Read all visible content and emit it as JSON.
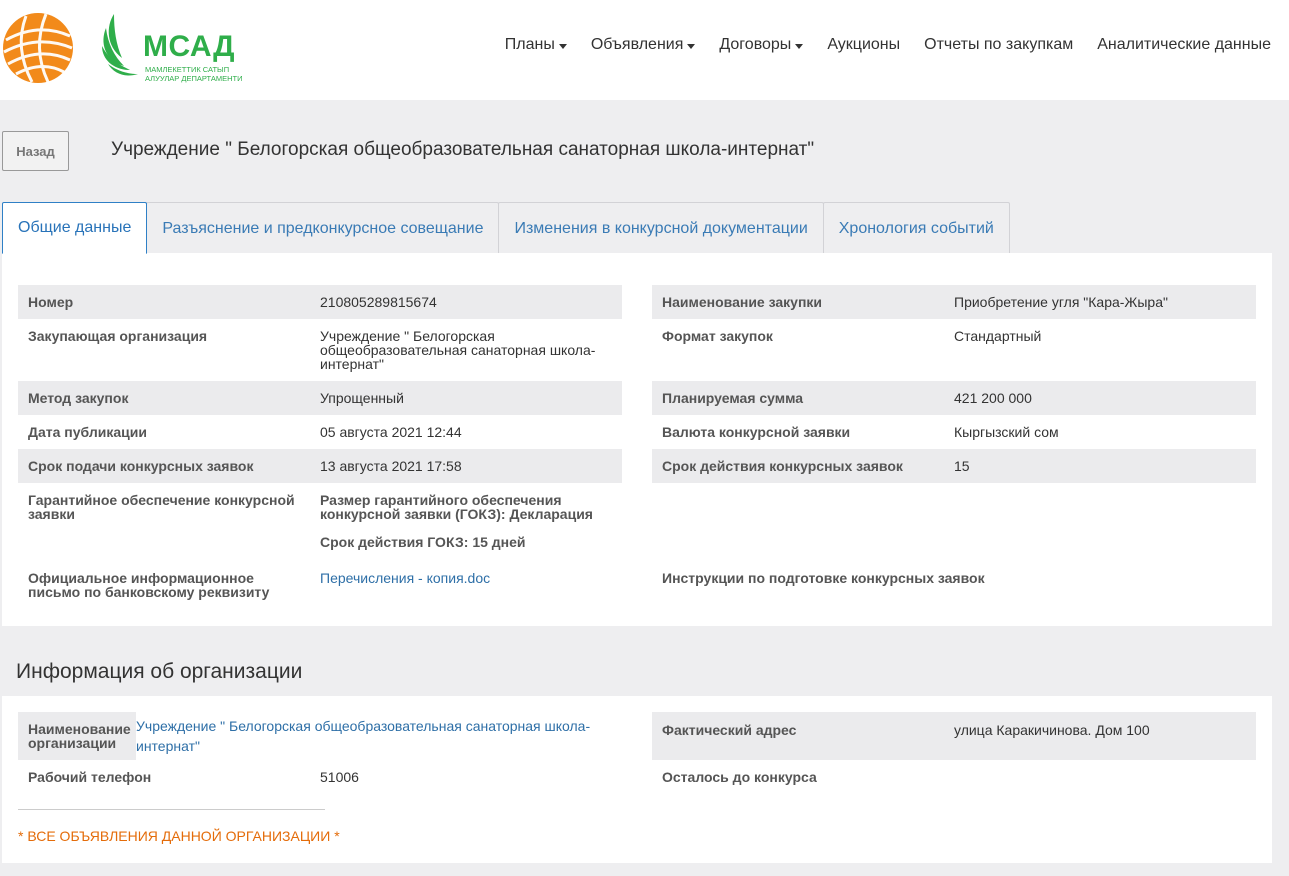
{
  "header": {
    "brand": "МСАД",
    "brand_sub": [
      "МАМЛЕКЕТТИК САТЫП",
      "АЛУУЛАР ДЕПАРТАМЕНТИ"
    ],
    "nav": [
      {
        "label": "Планы",
        "dropdown": true
      },
      {
        "label": "Объявления",
        "dropdown": true
      },
      {
        "label": "Договоры",
        "dropdown": true
      },
      {
        "label": "Аукционы",
        "dropdown": false
      },
      {
        "label": "Отчеты по закупкам",
        "dropdown": false
      },
      {
        "label": "Аналитические данные",
        "dropdown": false
      }
    ]
  },
  "back_label": "Назад",
  "page_title": "Учреждение \" Белогорская общеобразовательная санаторная школа-интернат\"",
  "tabs": [
    "Общие данные",
    "Разъяснение и предконкурсное совещание",
    "Изменения в конкурсной документации",
    "Хронология событий"
  ],
  "general": {
    "number_label": "Номер",
    "number": "210805289815674",
    "org_label": "Закупающая организация",
    "org": "Учреждение \" Белогорская общеобразовательная санаторная школа-интернат\"",
    "method_label": "Метод закупок",
    "method": "Упрощенный",
    "pub_label": "Дата публикации",
    "pub": "05 августа 2021 12:44",
    "deadline_label": "Срок подачи конкурсных заявок",
    "deadline": "13 августа 2021 17:58",
    "guarantee_label": "Гарантийное обеспечение конкурсной заявки",
    "guarantee_size": "Размер гарантийного обеспечения конкурсной заявки (ГОКЗ): Декларация",
    "guarantee_term": "Срок действия ГОКЗ: 15 дней",
    "letter_label": "Официальное информационное письмо по банковскому реквизиту",
    "letter_file": "Перечисления - копия.doc",
    "name_label": "Наименование закупки",
    "name": "Приобретение угля \"Кара-Жыра\"",
    "format_label": "Формат закупок",
    "format": "Стандартный",
    "sum_label": "Планируемая сумма",
    "sum": "421 200 000",
    "currency_label": "Валюта конкурсной заявки",
    "currency": "Кыргызский сом",
    "validity_label": "Срок действия конкурсных заявок",
    "validity": "15",
    "instructions_label": "Инструкции по подготовке конкурсных заявок"
  },
  "org_section": {
    "title": "Информация об организации",
    "name_label": "Наименование организации",
    "name": "Учреждение \" Белогорская общеобразовательная санаторная школа-интернат\"",
    "phone_label": "Рабочий телефон",
    "phone": "51006",
    "address_label": "Фактический адрес",
    "address": "улица Каракичинова. Дом 100",
    "remaining_label": "Осталось до конкурса",
    "all_ads": "* ВСЕ ОБЪЯВЛЕНИЯ ДАННОЙ ОРГАНИЗАЦИИ *"
  }
}
